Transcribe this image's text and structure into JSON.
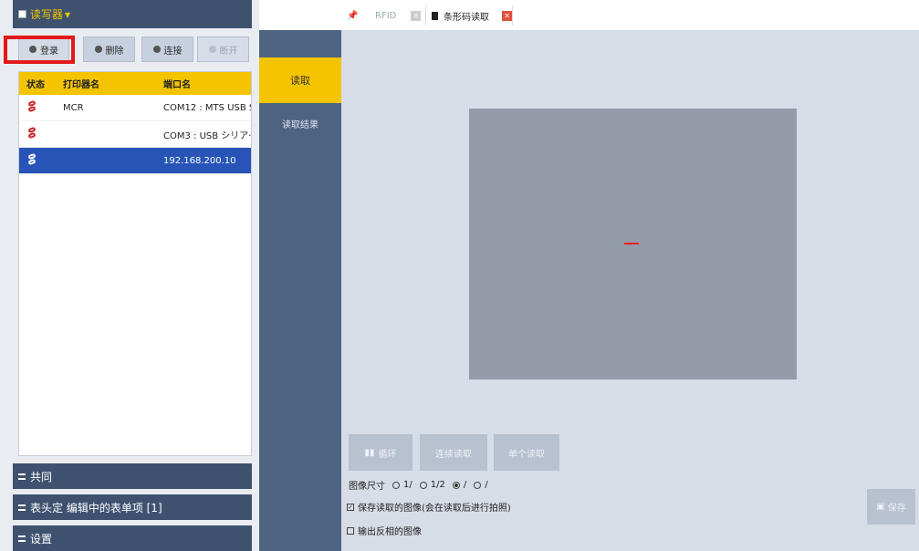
{
  "reader_panel": {
    "header": "读写器",
    "toolbar": {
      "add": "登录",
      "delete": "删除",
      "connect": "连接",
      "disconnect": "断开"
    },
    "table": {
      "columns": [
        "状态",
        "打印器名",
        "端口名"
      ],
      "rows": [
        {
          "name": "MCR",
          "port": "COM12 : MTS USB S···",
          "selected": false
        },
        {
          "name": "",
          "port": "COM3 : USB シリア···",
          "selected": false
        },
        {
          "name": "",
          "port": "192.168.200.10",
          "selected": true
        }
      ]
    }
  },
  "sections": {
    "shared": "共同",
    "tags": "表头定 编辑中的表单项 [1]",
    "settings": "设置"
  },
  "vertical_tabs": {
    "read": "读取",
    "results": "读取结果"
  },
  "tabs": {
    "rfid": "RFID",
    "barcode": "条形码读取"
  },
  "main": {
    "loop_button": "循环",
    "continuous_button": "连续读取",
    "single_button": "单个读取",
    "size_label": "图像尺寸",
    "size_options": [
      "1/",
      "1/2",
      "/",
      "/"
    ],
    "option1": "保存读取的图像(会在读取后进行拍照)",
    "option2": "输出反相的图像",
    "save_button": "保存"
  },
  "colors": {
    "accent_yellow": "#f5c400",
    "header_navy": "#3e5270",
    "selected_row": "#2854b8",
    "highlight_red": "#e41818"
  }
}
